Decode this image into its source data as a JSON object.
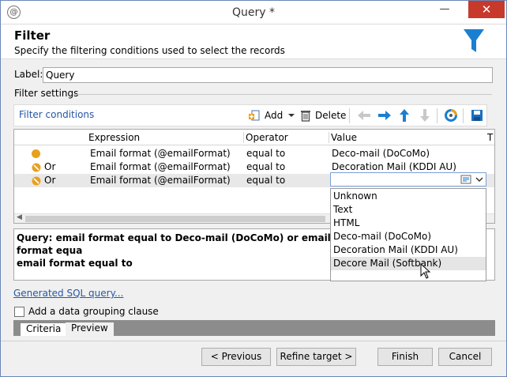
{
  "window": {
    "title": "Query *",
    "minimize_glyph": "—",
    "maximize_glyph": "□",
    "close_glyph": "✕",
    "app_icon": "@"
  },
  "header": {
    "title": "Filter",
    "subtitle": "Specify the filtering conditions used to select the records",
    "icon": "funnel-icon"
  },
  "label_field": {
    "label": "Label:",
    "value": "Query"
  },
  "section": {
    "title": "Filter settings"
  },
  "toolbar": {
    "title": "Filter conditions",
    "add_label": "Add",
    "delete_label": "Delete"
  },
  "grid": {
    "columns": [
      "Expression",
      "Operator",
      "Value",
      "T"
    ],
    "rows": [
      {
        "connector": "",
        "expression": "Email format (@emailFormat)",
        "operator": "equal to",
        "value": "Deco-mail (DoCoMo)"
      },
      {
        "connector": "Or",
        "expression": "Email format (@emailFormat)",
        "operator": "equal to",
        "value": "Decoration Mail (KDDI AU)"
      },
      {
        "connector": "Or",
        "expression": "Email format (@emailFormat)",
        "operator": "equal to",
        "value": ""
      }
    ]
  },
  "dropdown": {
    "options": [
      "Unknown",
      "Text",
      "HTML",
      "Deco-mail (DoCoMo)",
      "Decoration Mail (KDDI AU)",
      "Decore Mail (Softbank)"
    ],
    "highlighted_index": 5
  },
  "query": {
    "line1": "Query: email format equal to Deco-mail (DoCoMo) or email format",
    "line1_tail": "equa",
    "line2": "email format equal to"
  },
  "links": {
    "sql": "Generated SQL query..."
  },
  "grouping": {
    "label": "Add a data grouping clause",
    "checked": false
  },
  "tabs": [
    {
      "label": "Criteria",
      "active": true
    },
    {
      "label": "Preview",
      "active": false
    }
  ],
  "footer": {
    "previous": "< Previous",
    "refine": "Refine target >",
    "finish": "Finish",
    "cancel": "Cancel"
  },
  "colors": {
    "accent": "#2457a6",
    "bullet": "#e8a11c",
    "funnel": "#1a7fd1",
    "close": "#c7392b"
  }
}
